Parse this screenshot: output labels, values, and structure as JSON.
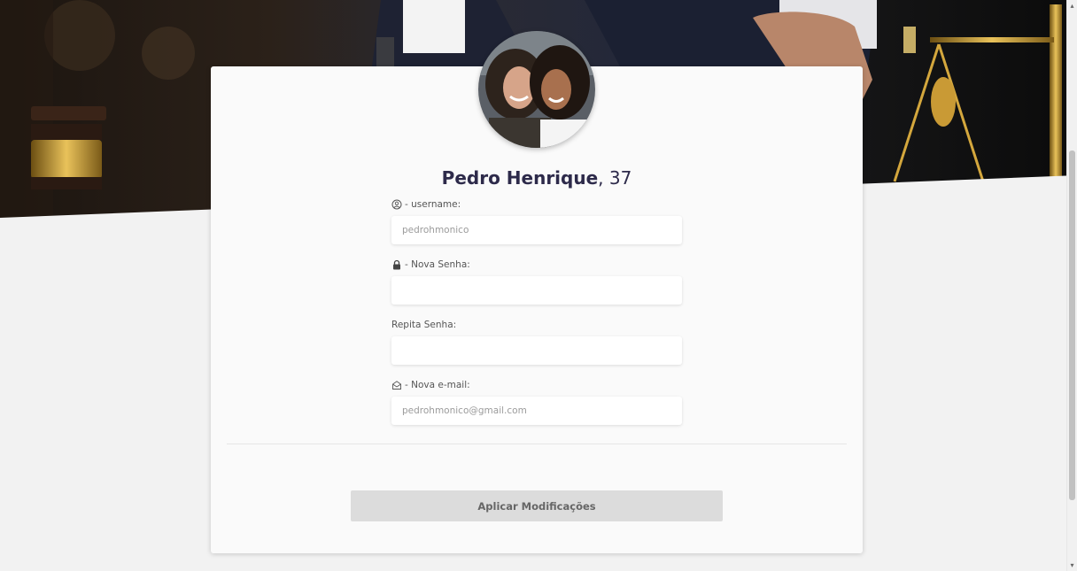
{
  "profile": {
    "name": "Pedro Henrique",
    "age_suffix": ", 37"
  },
  "form": {
    "username": {
      "label": " - username:",
      "icon": "user-circle-icon",
      "placeholder": "pedrohmonico"
    },
    "new_password": {
      "label": " - Nova Senha:",
      "icon": "lock-icon",
      "placeholder": ""
    },
    "repeat_password": {
      "label": "Repita Senha:",
      "placeholder": ""
    },
    "new_email": {
      "label": " - Nova e-mail:",
      "icon": "envelope-open-icon",
      "placeholder": "pedrohmonico@gmail.com"
    }
  },
  "actions": {
    "apply_label": "Aplicar Modificações"
  },
  "colors": {
    "name_text": "#2d2a4a",
    "button_bg": "#dcdcdc",
    "card_bg": "#fafafa",
    "page_bg": "#f2f2f2"
  }
}
